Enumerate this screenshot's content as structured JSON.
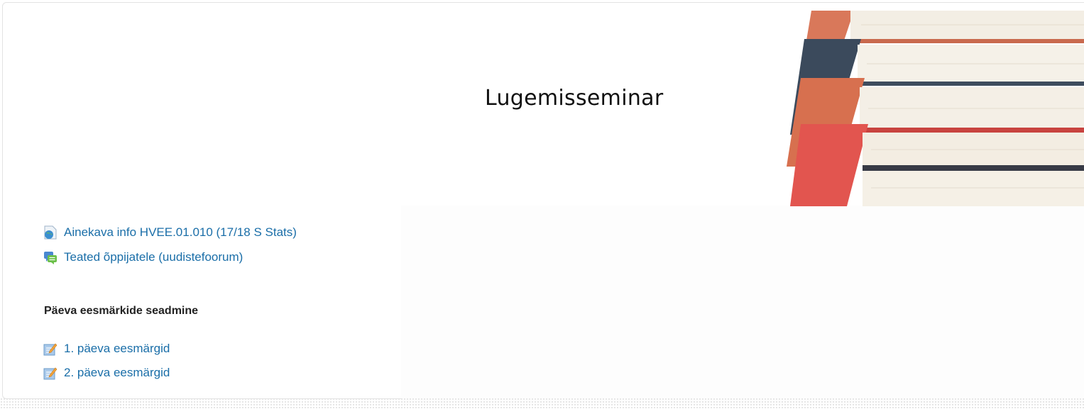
{
  "course": {
    "banner_title": "Lugemisseminar"
  },
  "activities_top": [
    {
      "label": "Ainekava info HVEE.01.010 (17/18 S Stats)",
      "icon": "url-globe-icon"
    },
    {
      "label": "Teated õppijatele (uudistefoorum)",
      "icon": "forum-icon"
    }
  ],
  "section": {
    "heading": "Päeva eesmärkide seadmine",
    "activities": [
      {
        "label": "1. päeva eesmärgid",
        "icon": "assignment-icon"
      },
      {
        "label": "2. päeva eesmärgid",
        "icon": "assignment-icon"
      }
    ]
  },
  "colors": {
    "link": "#1a6ea8",
    "heading": "#222222"
  }
}
